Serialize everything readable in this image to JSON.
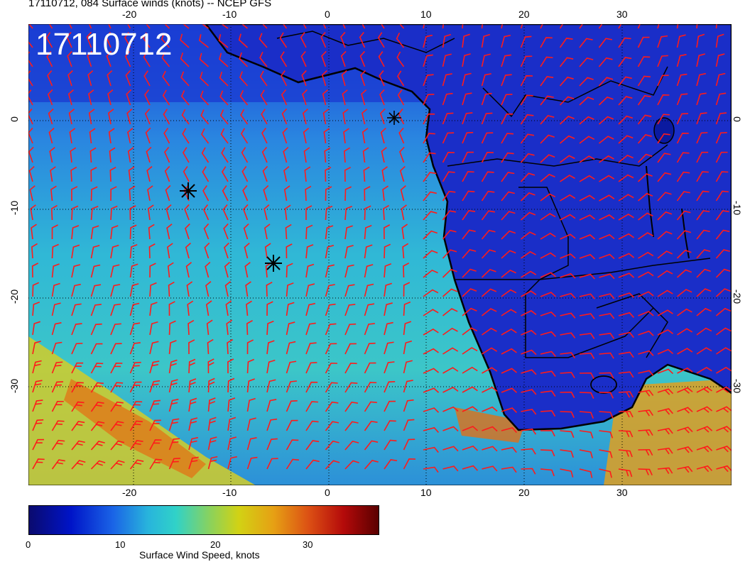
{
  "title": "17110712, 084 Surface winds (knots) -- NCEP GFS",
  "date_stamp": "17110712",
  "axes": {
    "lon_ticks": [
      "-20",
      "-10",
      "0",
      "10",
      "20",
      "30"
    ],
    "lat_ticks": [
      "0",
      "-10",
      "-20",
      "-30"
    ]
  },
  "colorbar": {
    "labels": [
      "0",
      "10",
      "20",
      "30"
    ],
    "title": "Surface Wind Speed, knots"
  },
  "colors": {
    "calm": "#0014c8",
    "moderate": "#30d2c8",
    "strong": "#e6a014",
    "barb": "#ff1a1a",
    "coast": "#000000"
  }
}
